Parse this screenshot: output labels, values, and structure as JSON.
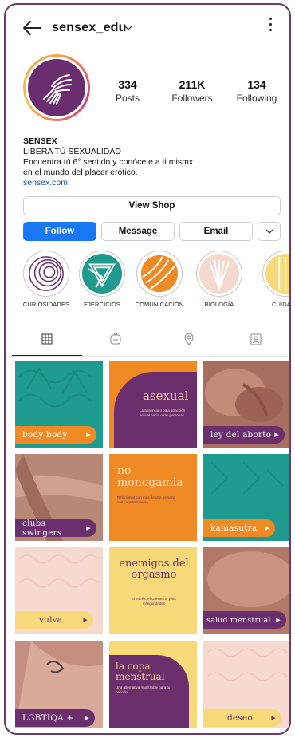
{
  "profile": {
    "username": "sensex_edu",
    "stats": [
      {
        "value": "334",
        "label": "Posts"
      },
      {
        "value": "211K",
        "label": "Followers"
      },
      {
        "value": "134",
        "label": "Following"
      }
    ],
    "bio": {
      "name": "SENSEX",
      "line1": "LIBERA TÚ SEXUALIDAD",
      "line2": "Encuentra tú 6° sentido y conócete a ti mismx",
      "line3": "en el mundo del placer erótico.",
      "link": "sensex.com"
    }
  },
  "buttons": {
    "view_shop": "View Shop",
    "follow": "Follow",
    "message": "Message",
    "email": "Email"
  },
  "highlights": [
    {
      "label": "CURIOSIDADES"
    },
    {
      "label": "EJERCICIOS"
    },
    {
      "label": "COMUNICACIÓN"
    },
    {
      "label": "BIOLOGÍA"
    },
    {
      "label": "CUIDA"
    }
  ],
  "tabs": [
    "grid-icon",
    "reels-icon",
    "location-pin-icon",
    "tagged-icon"
  ],
  "posts": [
    {
      "caption": "body body"
    },
    {
      "title": "asexual",
      "body": "La ausencia o baja atracción sexual hacia otras personas"
    },
    {
      "caption": "ley del aborto"
    },
    {
      "caption": "clubs swingers"
    },
    {
      "title": "no monogamia",
      "body": "Relaciones con más de una persona con consentimiento"
    },
    {
      "caption": "kamasutra"
    },
    {
      "caption": "vulva"
    },
    {
      "title": "enemigos del orgasmo",
      "body": "El estrés, el cansancio y las inseguridades"
    },
    {
      "caption": "salud menstrual"
    },
    {
      "caption": "LGBTIQA +"
    },
    {
      "title": "la copa menstrual",
      "body": "Una alternativa reutilizable para tu periodo"
    },
    {
      "caption": "deseo"
    }
  ],
  "colors": {
    "purple": "#6b2f6e",
    "teal": "#1f9a8e",
    "orange": "#ef8a24",
    "pink": "#f6d9ce",
    "yellow": "#f7d97a",
    "follow_blue": "#1877f2"
  }
}
